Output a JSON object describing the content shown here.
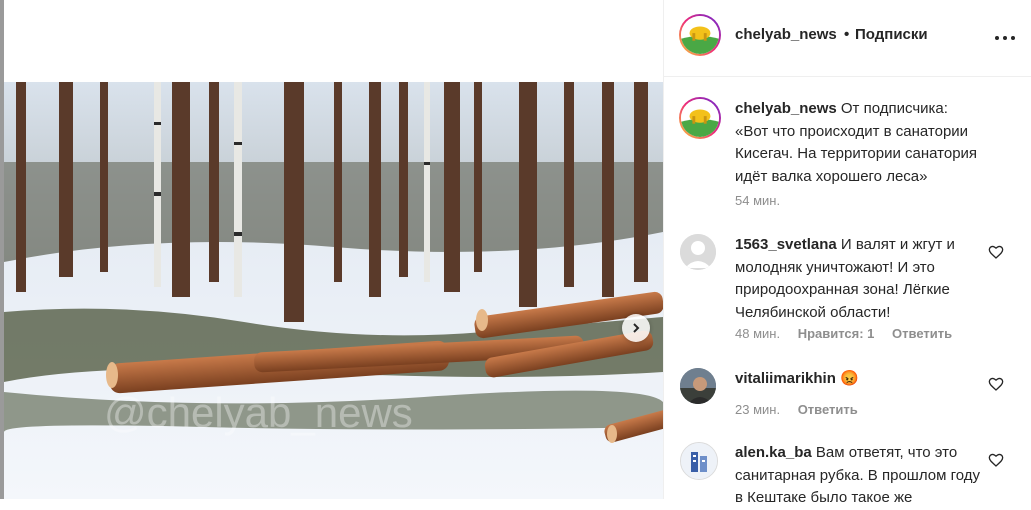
{
  "header": {
    "username": "chelyab_news",
    "separator": "•",
    "follow_status": "Подписки"
  },
  "photo": {
    "watermark": "@chelyab_news"
  },
  "caption": {
    "username": "chelyab_news",
    "text": "От подписчика: «Вот что происходит в санатории Кисегач. На территории санатория идёт валка хорошего леса»",
    "time": "54 мин."
  },
  "comments": [
    {
      "username": "1563_svetlana",
      "text": "И валят и жгут и молодняк уничтожают! И это природоохранная зона! Лёгкие Челябинской области!",
      "time": "48 мин.",
      "likes": "Нравится: 1",
      "reply": "Ответить"
    },
    {
      "username": "vitaliimarikhin",
      "text": "😡",
      "time": "23 мин.",
      "reply": "Ответить"
    },
    {
      "username": "alen.ka_ba",
      "text": "Вам ответят, что это санитарная рубка. В прошлом году в Кештаке было такое же",
      "time": "",
      "reply": ""
    }
  ],
  "colors": {
    "text": "#262626",
    "muted": "#8e8e8e",
    "border": "#efefef"
  }
}
